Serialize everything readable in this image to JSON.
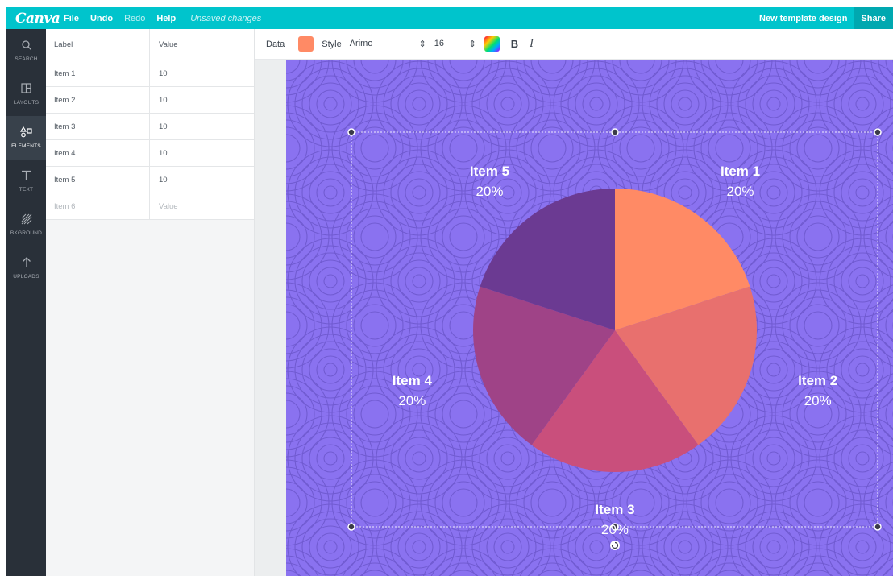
{
  "topbar": {
    "logo": "Canva",
    "menu": [
      "File",
      "Undo",
      "Redo",
      "Help"
    ],
    "unsaved": "Unsaved changes",
    "design_name": "New template design",
    "share": "Share"
  },
  "sidebar": {
    "items": [
      {
        "label": "SEARCH",
        "icon": "search-icon",
        "glyph": "⚲"
      },
      {
        "label": "LAYOUTS",
        "icon": "layouts-icon",
        "glyph": "◧"
      },
      {
        "label": "ELEMENTS",
        "icon": "elements-icon",
        "glyph": "△□"
      },
      {
        "label": "TEXT",
        "icon": "text-icon",
        "glyph": "T"
      },
      {
        "label": "BKGROUND",
        "icon": "background-icon",
        "glyph": "▨"
      },
      {
        "label": "UPLOADS",
        "icon": "upload-icon",
        "glyph": "↑"
      }
    ]
  },
  "data_table": {
    "headers": {
      "label": "Label",
      "value": "Value"
    },
    "rows": [
      {
        "label": "Item 1",
        "value": "10"
      },
      {
        "label": "Item 2",
        "value": "10"
      },
      {
        "label": "Item 3",
        "value": "10"
      },
      {
        "label": "Item 4",
        "value": "10"
      },
      {
        "label": "Item 5",
        "value": "10"
      }
    ],
    "placeholder_row": {
      "label": "Item 6",
      "value": "Value"
    }
  },
  "toolbar": {
    "data_label": "Data",
    "style_label": "Style",
    "font": "Arimo",
    "size": "16",
    "bold": "B",
    "italic": "I",
    "updown_arrow": "⇕"
  },
  "colors": {
    "topbar": "#00c4cc",
    "canvas": "#8a72f0",
    "swatch": "#ff8a65"
  },
  "chart_data": {
    "type": "pie",
    "categories": [
      "Item 1",
      "Item 2",
      "Item 3",
      "Item 4",
      "Item 5"
    ],
    "values": [
      10,
      10,
      10,
      10,
      10
    ],
    "percent_labels": [
      "20%",
      "20%",
      "20%",
      "20%",
      "20%"
    ],
    "colors": [
      "#ff8a65",
      "#e8706e",
      "#c94f7c",
      "#9f4387",
      "#6b3a92"
    ]
  }
}
